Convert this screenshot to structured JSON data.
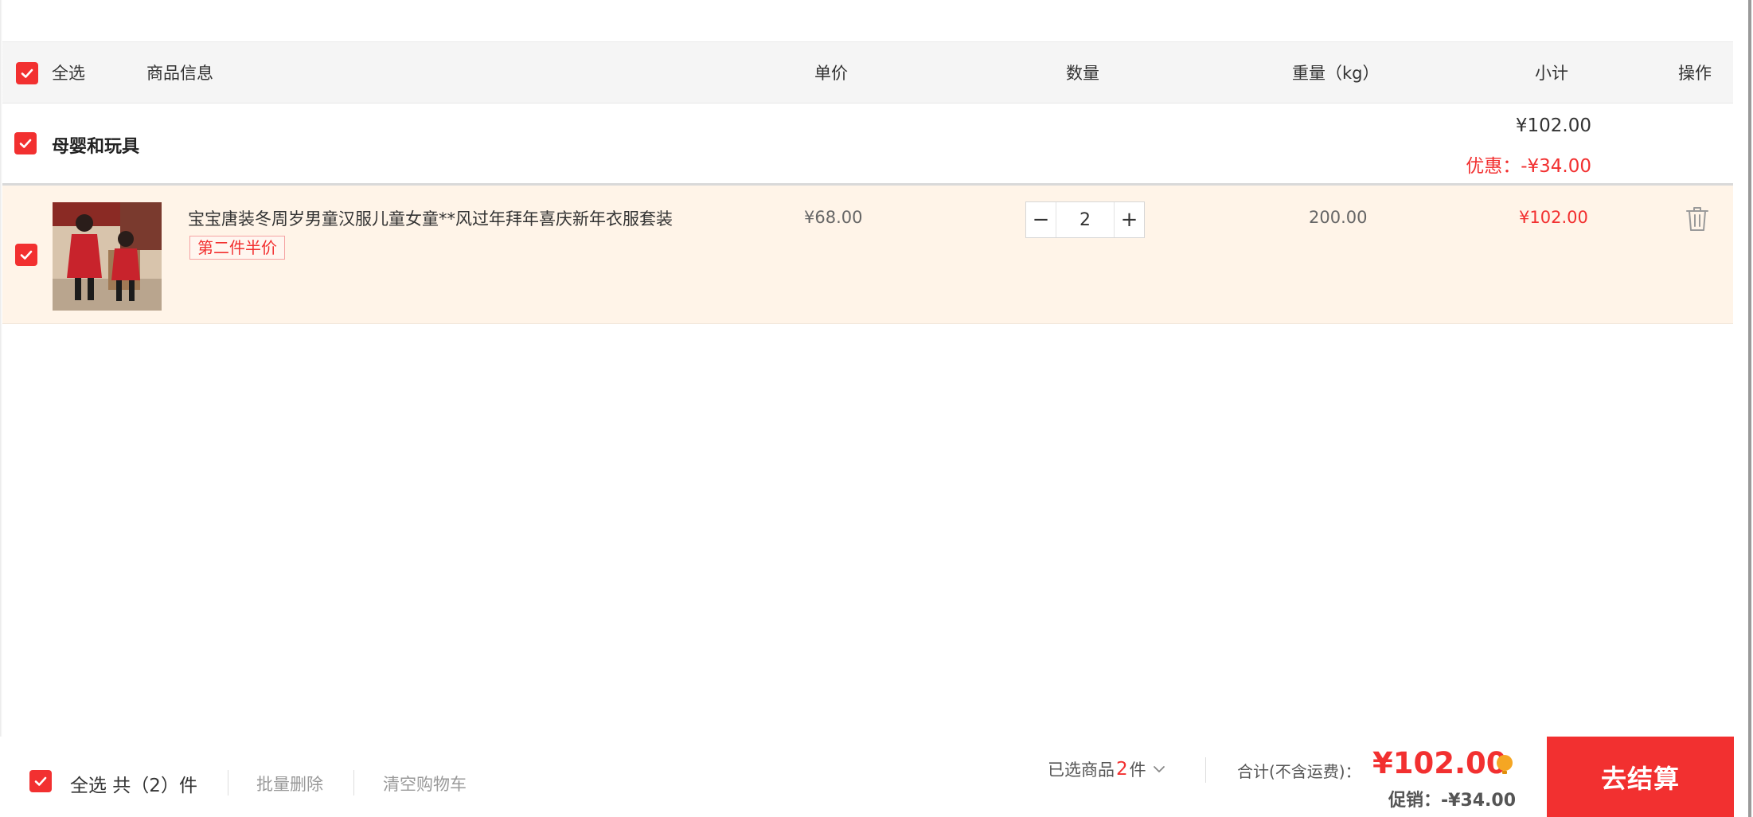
{
  "header": {
    "select_all": "全选",
    "product_info": "商品信息",
    "unit_price": "单价",
    "quantity": "数量",
    "weight": "重量（kg）",
    "subtotal": "小计",
    "action": "操作"
  },
  "shop": {
    "name": "母婴和玩具",
    "total": "¥102.00",
    "discount": "优惠：-¥34.00"
  },
  "item": {
    "title": "宝宝唐装冬周岁男童汉服儿童女童**风过年拜年喜庆新年衣服套装",
    "promo": "第二件半价",
    "unit_price": "¥68.00",
    "quantity": "2",
    "weight": "200.00",
    "subtotal": "¥102.00",
    "minus": "−",
    "plus": "+"
  },
  "footer": {
    "select_all_count": "全选 共（2）件",
    "batch_delete": "批量删除",
    "clear_cart": "清空购物车",
    "selected_prefix": "已选商品",
    "selected_count": "2",
    "selected_suffix": "件",
    "total_label": "合计(不含运费)：",
    "total_value": "¥102.00",
    "promo_saving": "促销：-¥34.00",
    "checkout": "去结算"
  },
  "colors": {
    "accent": "#f23030",
    "header_bg": "#f5f5f5",
    "item_bg": "#fff4e8",
    "coin": "#f5a623"
  },
  "icons": {
    "checkbox": "check-icon",
    "delete": "trash-icon",
    "dropdown": "chevron-down-icon",
    "hint": "coin-icon"
  }
}
